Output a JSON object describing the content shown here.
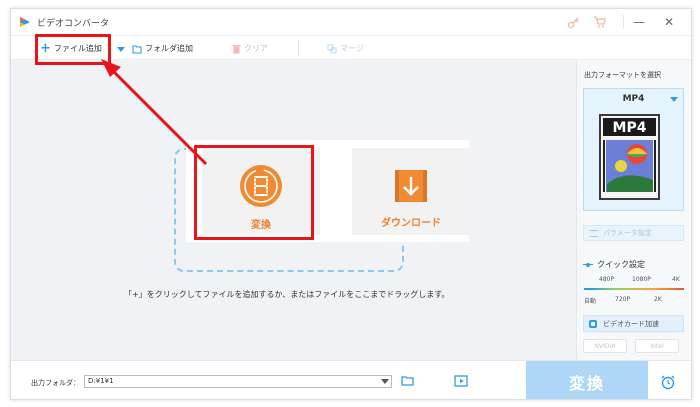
{
  "window": {
    "title": "ビデオコンバータ"
  },
  "toolbar": {
    "add_file": "ファイル追加",
    "add_folder": "フォルダ追加",
    "clear": "クリア",
    "merge": "マージ"
  },
  "main": {
    "convert_card": "変換",
    "download_card": "ダウンロード",
    "hint": "「+」をクリックしてファイルを追加するか、またはファイルをここまでドラッグします。"
  },
  "sidebar": {
    "title": "出力フォーマットを選択",
    "format": "MP4",
    "format_icon_text": "MP4",
    "param_button": "パラメータ設定",
    "quick_title": "クイック設定",
    "quality_top": [
      "480P",
      "1080P",
      "4K"
    ],
    "quality_bottom": [
      "自動",
      "720P",
      "2K"
    ],
    "gpu_button": "ビデオカード加速",
    "gpu_chips": [
      "NVIDIA",
      "Intel"
    ]
  },
  "bottom": {
    "output_label": "出力フォルダ：",
    "output_path": "D:¥1¥1",
    "convert_button": "変換"
  },
  "colors": {
    "accent": "#2e9be9",
    "orange": "#e9822f",
    "annotation_red": "#e8141b",
    "convert_disabled": "#aed6f6"
  }
}
